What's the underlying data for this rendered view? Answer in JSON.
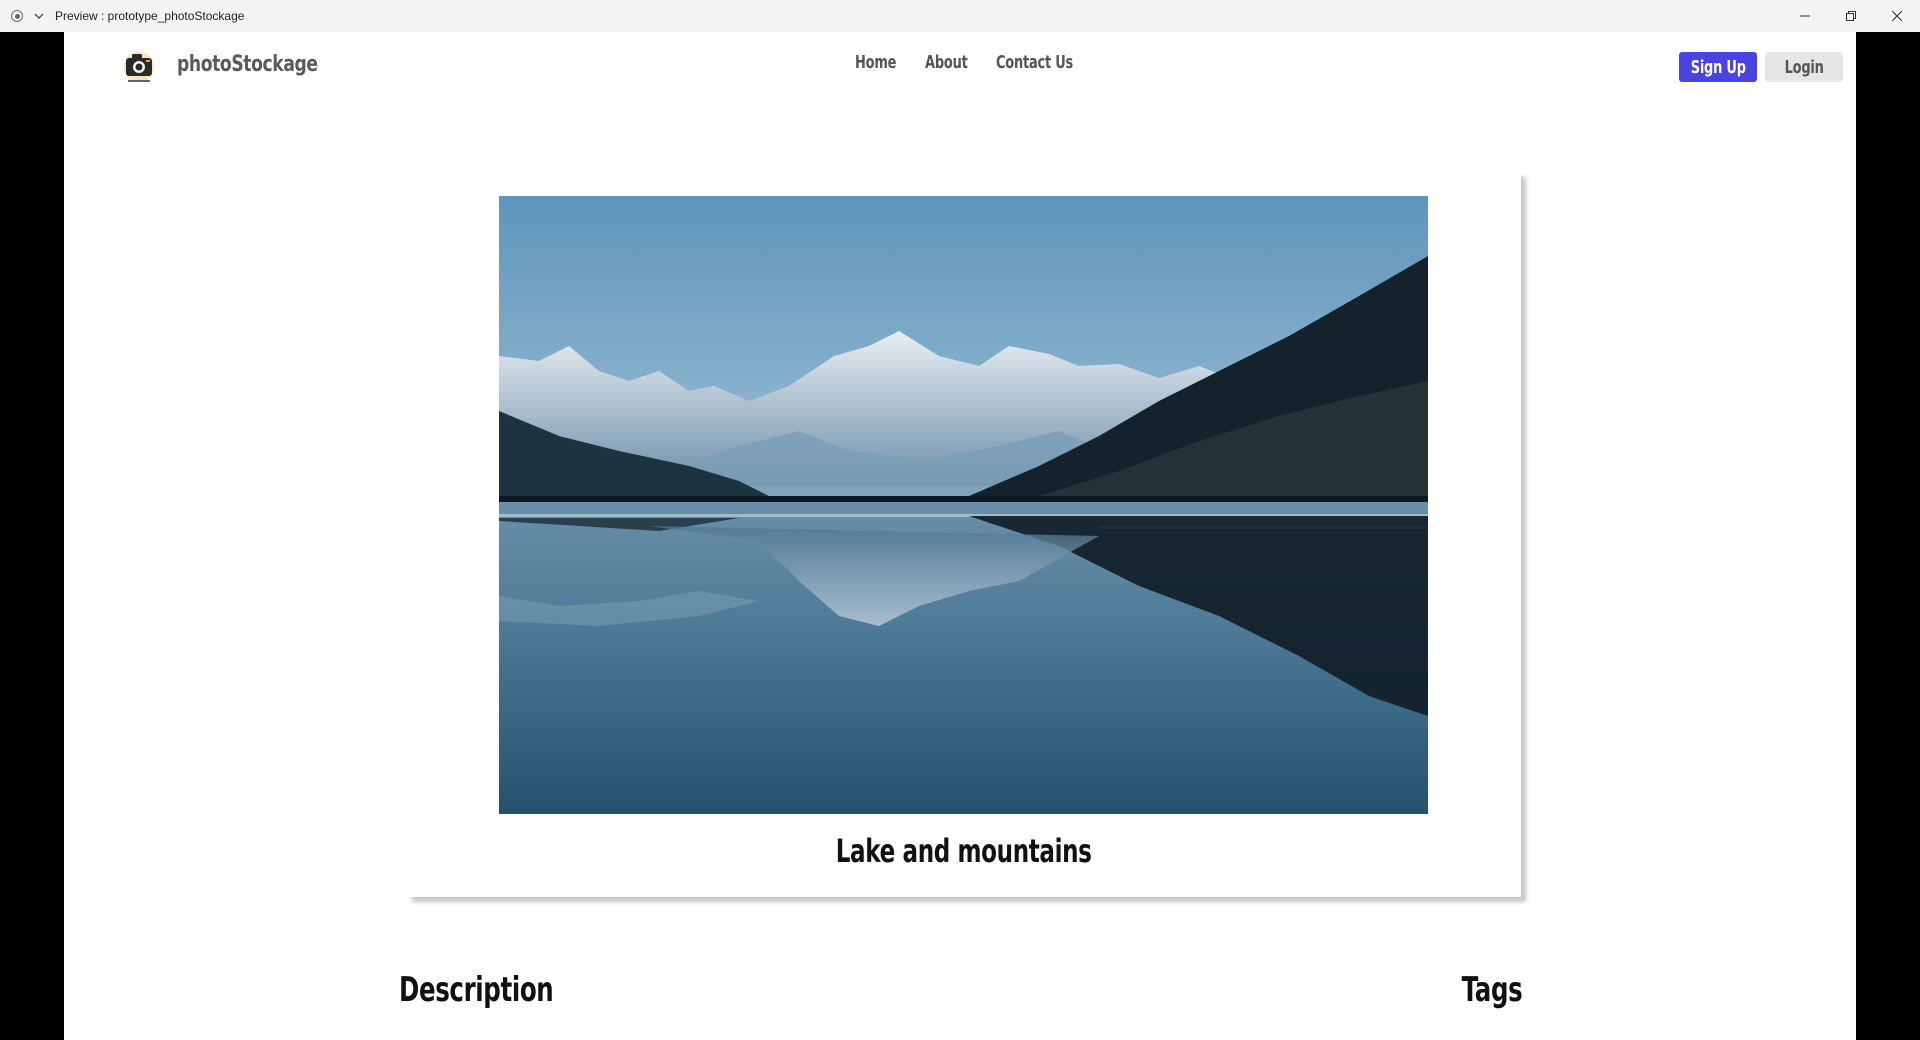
{
  "window": {
    "title": "Preview : prototype_photoStockage"
  },
  "header": {
    "brand": "photoStockage",
    "nav": [
      "Home",
      "About",
      "Contact Us"
    ],
    "signup_label": "Sign Up",
    "login_label": "Login"
  },
  "photo": {
    "caption": "Lake and mountains"
  },
  "sections": {
    "description_heading": "Description",
    "tags_heading": "Tags"
  },
  "colors": {
    "signup_bg": "#4b43e0",
    "login_bg": "#e6e6e6",
    "page_bg": "#ffffff",
    "frame_bg": "#000000"
  },
  "icons": [
    "record-icon",
    "chevron-down-icon",
    "minimize-icon",
    "restore-icon",
    "close-icon",
    "camera-logo-icon"
  ]
}
